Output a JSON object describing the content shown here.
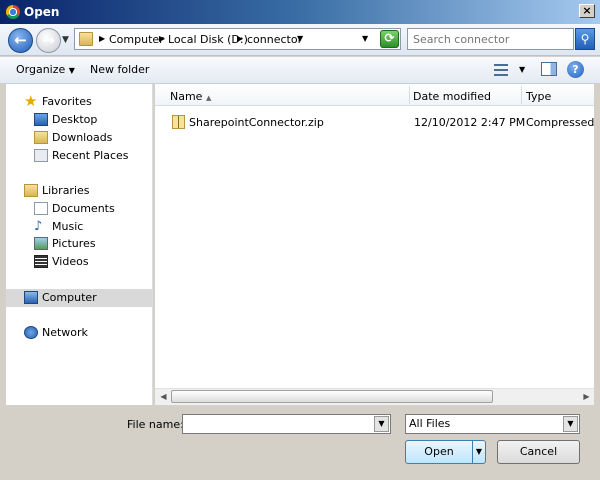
{
  "window": {
    "title": "Open",
    "close_label": "×"
  },
  "nav": {
    "back_glyph": "←",
    "forward_glyph": "→",
    "breadcrumb": [
      "Computer",
      "Local Disk (D:)",
      "connector"
    ],
    "search_placeholder": "Search connector"
  },
  "toolbar": {
    "organize_label": "Organize",
    "new_folder_label": "New folder",
    "help_label": "?"
  },
  "sidebar": {
    "items": [
      {
        "label": "Favorites",
        "icon": "star-icon"
      },
      {
        "label": "Desktop",
        "icon": "desktop-icon"
      },
      {
        "label": "Downloads",
        "icon": "downloads-icon"
      },
      {
        "label": "Recent Places",
        "icon": "recent-places-icon"
      },
      {
        "label": "Libraries",
        "icon": "libraries-icon"
      },
      {
        "label": "Documents",
        "icon": "documents-icon"
      },
      {
        "label": "Music",
        "icon": "music-icon"
      },
      {
        "label": "Pictures",
        "icon": "pictures-icon"
      },
      {
        "label": "Videos",
        "icon": "videos-icon"
      },
      {
        "label": "Computer",
        "icon": "computer-icon",
        "selected": true
      },
      {
        "label": "Network",
        "icon": "network-icon"
      }
    ]
  },
  "files": {
    "columns": [
      "Name",
      "Date modified",
      "Type"
    ],
    "rows": [
      {
        "name": "SharepointConnector.zip",
        "date": "12/10/2012 2:47 PM",
        "type": "Compressed (zip"
      }
    ]
  },
  "footer": {
    "file_name_label": "File name:",
    "file_name_value": "",
    "filter_value": "All Files",
    "open_label": "Open",
    "cancel_label": "Cancel"
  },
  "colors": {
    "title_bar": "#0a246a",
    "selected_nav": "#d9d9d9",
    "open_button": "#bee6fd"
  }
}
